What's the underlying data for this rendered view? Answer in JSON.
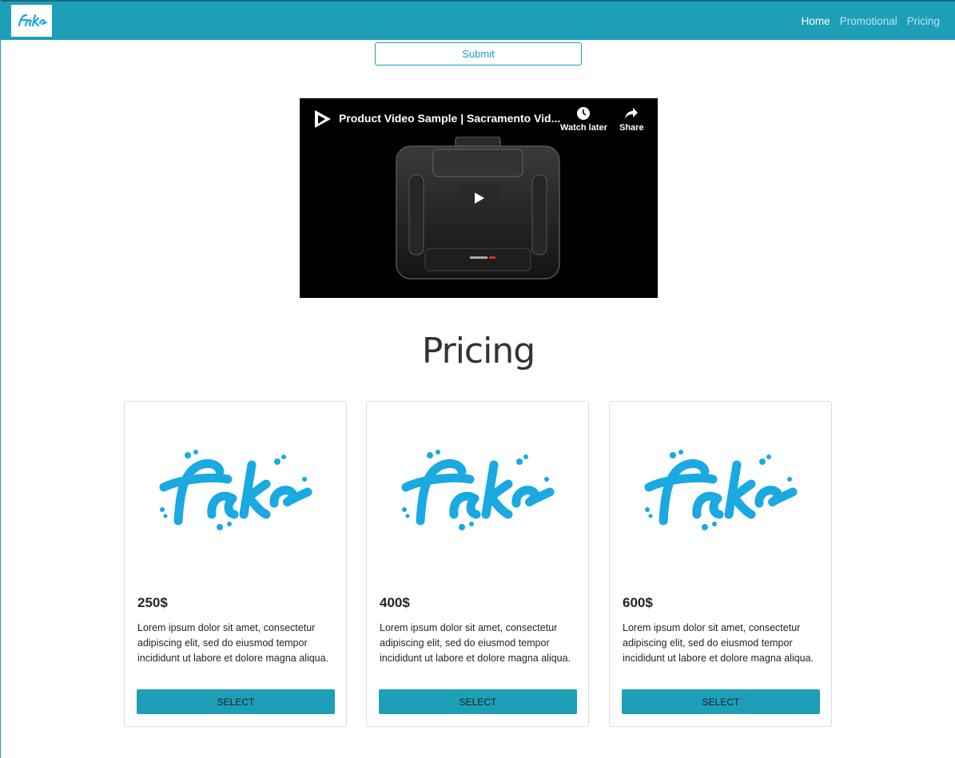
{
  "nav": {
    "brand_alt": "Fake logo",
    "links": [
      {
        "label": "Home",
        "active": true
      },
      {
        "label": "Promotional",
        "active": false
      },
      {
        "label": "Pricing",
        "active": false
      }
    ]
  },
  "form": {
    "submit_label": "Submit"
  },
  "video": {
    "title": "Product Video Sample | Sacramento Vid...",
    "watch_later_label": "Watch later",
    "share_label": "Share"
  },
  "pricing": {
    "heading": "Pricing",
    "logo_text": "Fake",
    "cards": [
      {
        "price": "250$",
        "description": "Lorem ipsum dolor sit amet, consectetur adipiscing elit, sed do eiusmod tempor incididunt ut labore et dolore magna aliqua.",
        "button_label": "SELECT"
      },
      {
        "price": "400$",
        "description": "Lorem ipsum dolor sit amet, consectetur adipiscing elit, sed do eiusmod tempor incididunt ut labore et dolore magna aliqua.",
        "button_label": "SELECT"
      },
      {
        "price": "600$",
        "description": "Lorem ipsum dolor sit amet, consectetur adipiscing elit, sed do eiusmod tempor incididunt ut labore et dolore magna aliqua.",
        "button_label": "SELECT"
      }
    ]
  },
  "colors": {
    "accent": "#1e9fb8",
    "logo_blue": "#1aa9e0"
  }
}
